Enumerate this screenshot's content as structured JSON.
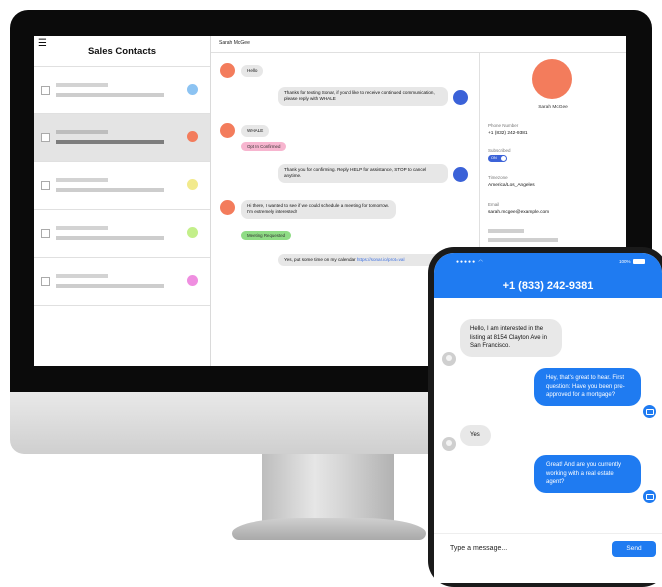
{
  "desktop": {
    "sidebar": {
      "title": "Sales Contacts",
      "rows": [
        {
          "dot_color": "#8cc3f2"
        },
        {
          "dot_color": "#f37c5c",
          "active": true
        },
        {
          "dot_color": "#f2ea8c"
        },
        {
          "dot_color": "#c3ef8a"
        },
        {
          "dot_color": "#ef8ee0"
        }
      ]
    },
    "conversation": {
      "contact_name": "Sarah McGee",
      "messages": {
        "m1": "Hello",
        "m2": "Thanks for texting Sonar, if you'd like to receive continued communication, please reply with WHALE",
        "m3": "WHALE",
        "tag_optin": "Opt In Confirmed",
        "m4": "Thank you for confirming. Reply HELP for assistance, STOP to cancel anytime.",
        "m5": "Hi there, I wanted to see if we could schedule a meeting for tomorrow. I'm extremely interested!",
        "tag_meeting": "Meeting Requested",
        "m6_text": "Yes, put some time on my calendar ",
        "m6_link": "https://sonar.io/prot=val"
      }
    },
    "details": {
      "name": "Sarah McGee",
      "phone_label": "Phone Number",
      "phone_value": "+1 (832) 242-9381",
      "subscribed_label": "Subscribed",
      "subscribed_toggle": "ON",
      "timezone_label": "Timezone",
      "timezone_value": "America/Los_Angeles",
      "email_label": "Email",
      "email_value": "sarah.mcgee@example.com"
    },
    "colors": {
      "contact_avatar": "#f37c5c",
      "bot_avatar": "#3b62d8",
      "accent": "#1f7bf1"
    }
  },
  "phone": {
    "status": {
      "battery": "100%"
    },
    "title": "+1 (833) 242-9381",
    "messages": {
      "in1": "Hello, I am interested in the listing at 8154 Clayton Ave in San Francisco.",
      "out1": "Hey, that's great to hear. First question: Have you been pre-approved for a mortgage?",
      "in2": "Yes",
      "out2": "Great! And are you currently working with a real estate agent?"
    },
    "input_placeholder": "Type a message...",
    "send_label": "Send"
  }
}
